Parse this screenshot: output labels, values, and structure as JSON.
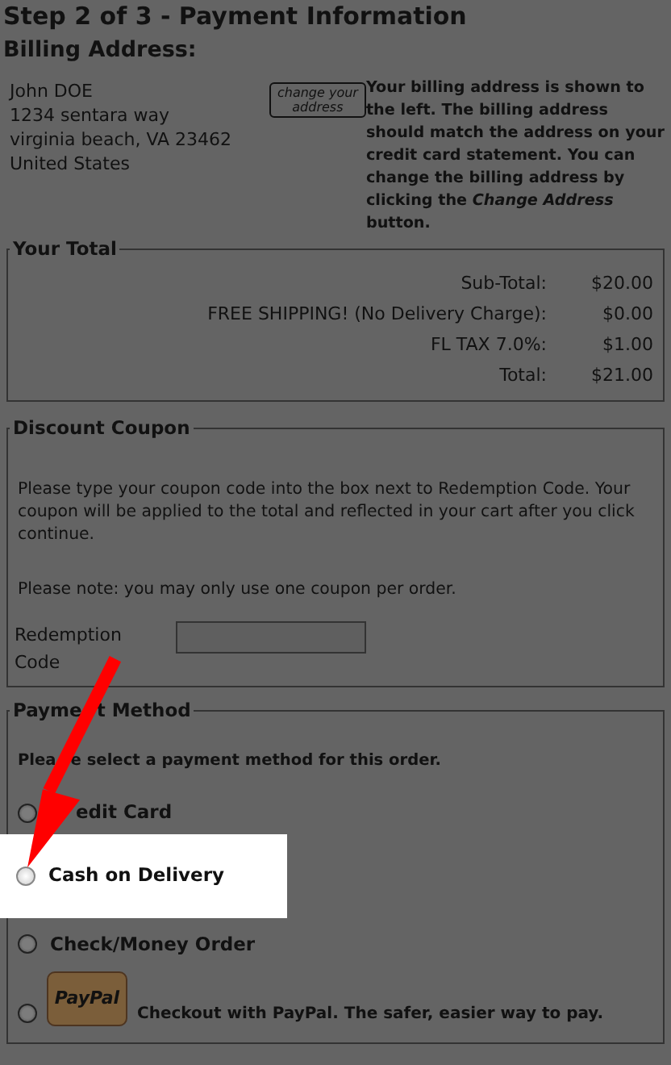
{
  "page_title": "Step 2 of 3 - Payment Information",
  "billing": {
    "heading": "Billing Address:",
    "address_lines": [
      "John DOE",
      "1234 sentara way",
      "virginia beach, VA 23462",
      "United States"
    ],
    "change_button": "change your address",
    "note": "Your billing address is shown to the left. The billing address should match the address on your credit card statement. You can change the billing address by clicking the *Change Address* button."
  },
  "total": {
    "legend": "Your Total",
    "rows": [
      {
        "label": "Sub-Total:",
        "value": "$20.00"
      },
      {
        "label": "FREE SHIPPING! (No Delivery Charge):",
        "value": "$0.00"
      },
      {
        "label": "FL TAX 7.0%:",
        "value": "$1.00"
      },
      {
        "label": "Total:",
        "value": "$21.00"
      }
    ]
  },
  "coupon": {
    "legend": "Discount Coupon",
    "text": "Please type your coupon code into the box next to Redemption Code. Your coupon will be applied to the total and reflected in your cart after you click continue.",
    "note": "Please note: you may only use one coupon per order.",
    "field_label": "Redemption Code"
  },
  "payment": {
    "legend_parts": [
      "Payme",
      "t Method"
    ],
    "prompt_parts": [
      "Plea",
      "e select a payment method for this order."
    ],
    "options": [
      {
        "kind": "text",
        "label": "edit Card",
        "selected": false,
        "highlighted": false
      },
      {
        "kind": "text",
        "label": "Cash on Delivery",
        "selected": false,
        "highlighted": true
      },
      {
        "kind": "text",
        "label": "Check/Money Order",
        "selected": false,
        "highlighted": false
      },
      {
        "kind": "logo",
        "logo_text": "PayPal",
        "label": "Checkout with PayPal. The safer, easier way to pay.",
        "selected": false,
        "highlighted": false
      }
    ]
  },
  "pointer_arrow": true
}
